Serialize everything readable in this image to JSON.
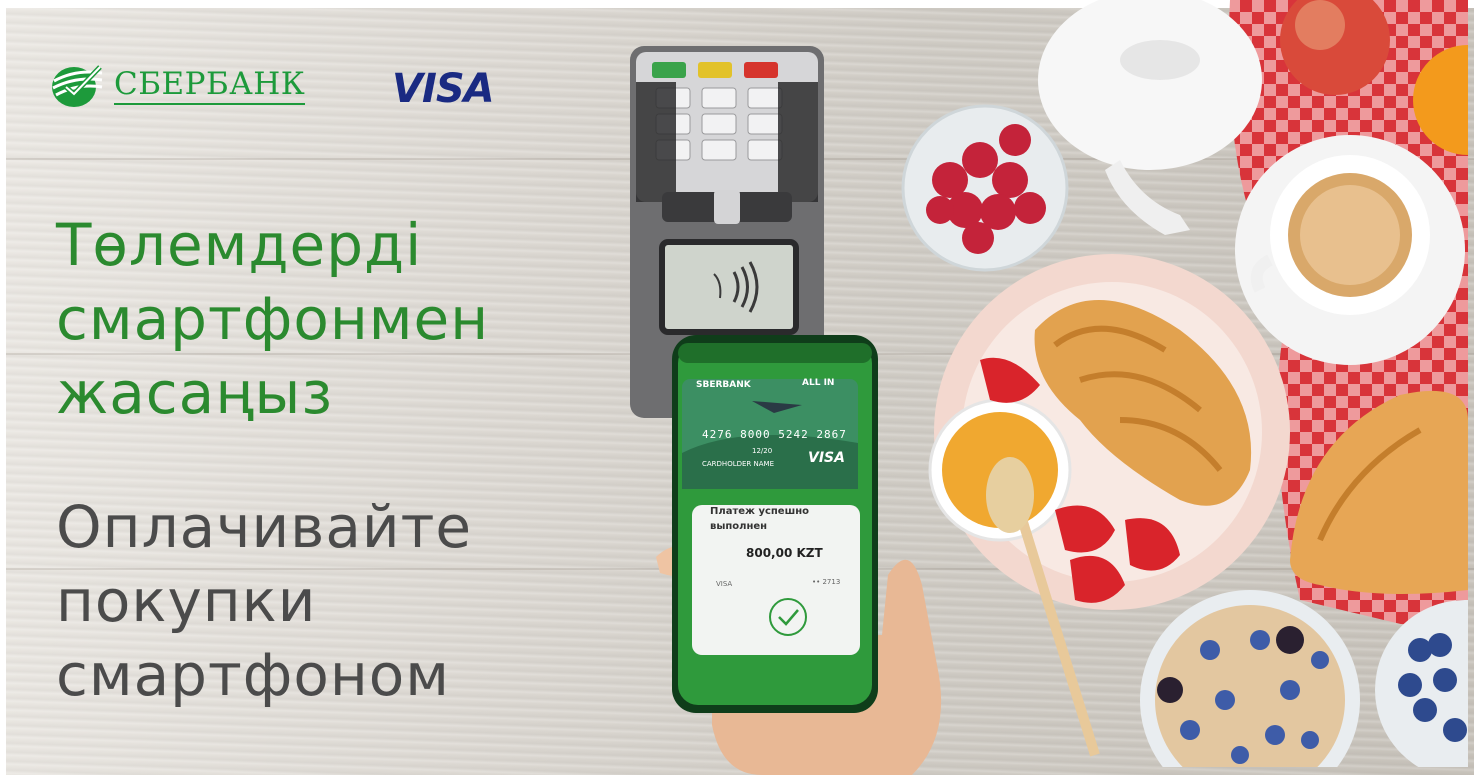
{
  "brand": {
    "bank_name": "СБЕРБАНК",
    "card_network": "VISA",
    "brand_color": "#1d9a3b",
    "visa_color": "#1a2a82"
  },
  "headline": {
    "lines": [
      "Төлемдерді",
      "смартфонмен",
      "жасаңыз"
    ],
    "color": "#2b8a2f"
  },
  "subline": {
    "lines": [
      "Оплачивайте",
      "покупки",
      "смартфоном"
    ],
    "color": "#4b4b4b"
  },
  "phone": {
    "card": {
      "issuer": "SBERBANK",
      "tag": "ALL IN",
      "number": "4276 8000 5242 2867",
      "expiry": "12/20",
      "holder": "CARDHOLDER NAME",
      "network": "VISA"
    },
    "payment": {
      "status": "Платеж успешно выполнен",
      "amount": "800,00 KZT",
      "network": "VISA",
      "last4": "•• 2713"
    }
  },
  "icons": [
    "sberbank-logo-icon",
    "contactless-icon",
    "checkmark-icon"
  ]
}
